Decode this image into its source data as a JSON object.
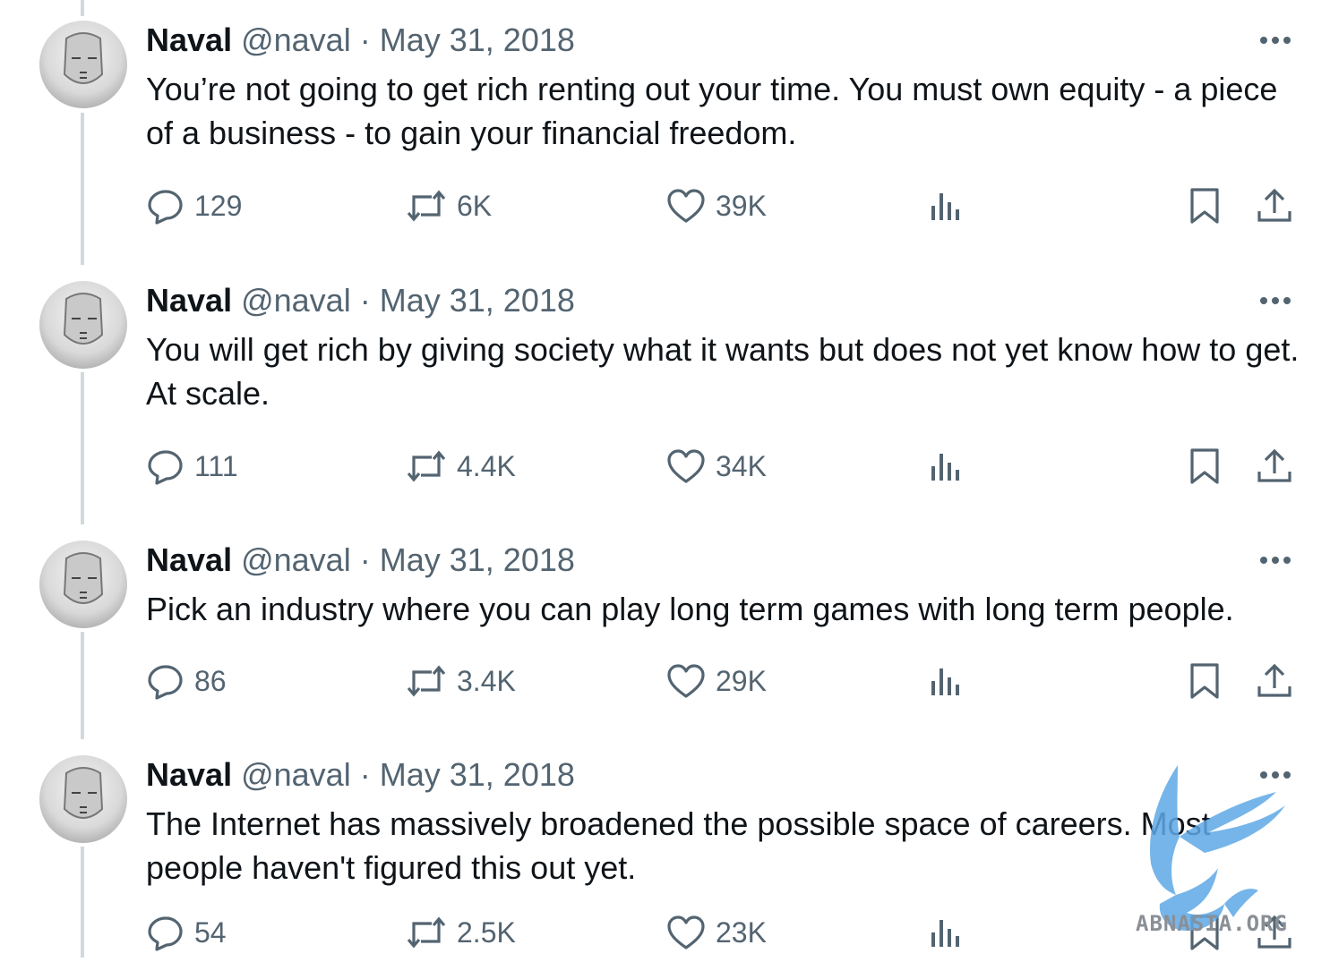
{
  "tweets": [
    {
      "name": "Naval",
      "handle": "@naval",
      "sep": "·",
      "date": "May 31, 2018",
      "text": "You’re not going to get rich renting out your time. You must own equity - a piece of a business - to gain your financial freedom.",
      "replies": "129",
      "retweets": "6K",
      "likes": "39K"
    },
    {
      "name": "Naval",
      "handle": "@naval",
      "sep": "·",
      "date": "May 31, 2018",
      "text": "You will get rich by giving society what it wants but does not yet know how to get. At scale.",
      "replies": "111",
      "retweets": "4.4K",
      "likes": "34K"
    },
    {
      "name": "Naval",
      "handle": "@naval",
      "sep": "·",
      "date": "May 31, 2018",
      "text": "Pick an industry where you can play long term games with long term people.",
      "replies": "86",
      "retweets": "3.4K",
      "likes": "29K"
    },
    {
      "name": "Naval",
      "handle": "@naval",
      "sep": "·",
      "date": "May 31, 2018",
      "text": "The Internet has massively broadened the possible space of careers. Most people haven't figured this out yet.",
      "replies": "54",
      "retweets": "2.5K",
      "likes": "23K"
    }
  ],
  "icons": {
    "reply": "reply-icon",
    "retweet": "retweet-icon",
    "like": "heart-icon",
    "views": "views-icon",
    "bookmark": "bookmark-icon",
    "share": "share-icon",
    "more": "more-icon"
  },
  "watermark": {
    "text": "ABNASIA.ORG"
  },
  "colors": {
    "text": "#0f1419",
    "secondary": "#536471",
    "thread_line": "#cfd9de",
    "watermark_blue": "#5ea9e6"
  }
}
